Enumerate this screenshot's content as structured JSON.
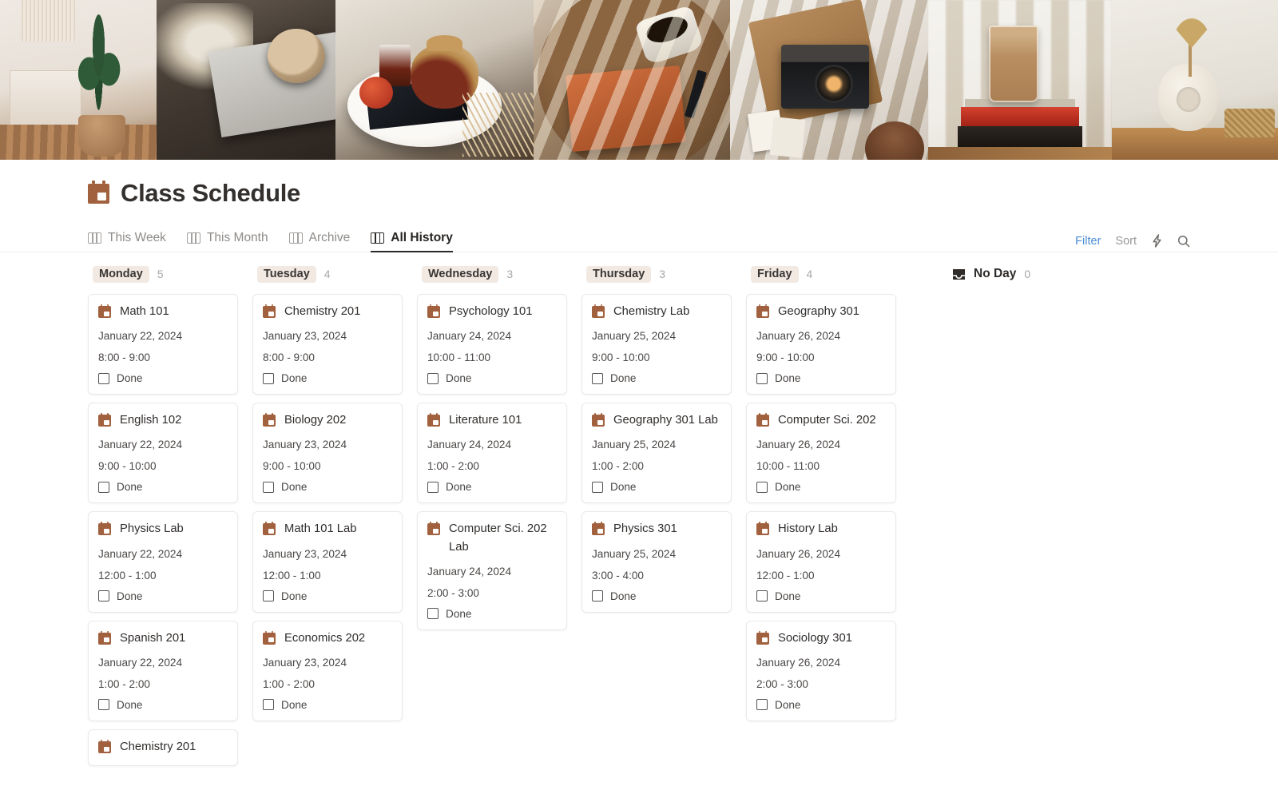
{
  "header": {
    "title": "Class Schedule",
    "title_icon": "calendar-icon"
  },
  "tabs": [
    {
      "label": "This Week",
      "icon": "board-view-icon",
      "active": false
    },
    {
      "label": "This Month",
      "icon": "board-view-icon",
      "active": false
    },
    {
      "label": "Archive",
      "icon": "board-view-icon",
      "active": false
    },
    {
      "label": "All History",
      "icon": "board-view-icon",
      "active": true
    }
  ],
  "toolbar": {
    "filter_label": "Filter",
    "sort_label": "Sort",
    "automation_icon": "lightning-bolt-icon",
    "search_icon": "search-icon",
    "filter_color": "#4a8bd4",
    "sort_color": "#9b9896"
  },
  "colors": {
    "pill_background": "#f2e9e3",
    "card_icon": "#a2613e",
    "accent_blue": "#4a8bd4",
    "card_border": "#ebe9e7",
    "count_text": "#a9a6a3"
  },
  "board": {
    "done_label": "Done",
    "columns": [
      {
        "name": "Monday",
        "count": "5",
        "cards": [
          {
            "title": "Math 101",
            "date": "January 22, 2024",
            "time": "8:00 - 9:00",
            "done": false
          },
          {
            "title": "English 102",
            "date": "January 22, 2024",
            "time": "9:00 - 10:00",
            "done": false
          },
          {
            "title": "Physics Lab",
            "date": "January 22, 2024",
            "time": "12:00 - 1:00",
            "done": false
          },
          {
            "title": "Spanish 201",
            "date": "January 22, 2024",
            "time": "1:00 - 2:00",
            "done": false
          },
          {
            "title": "Chemistry 201",
            "date": "",
            "time": "",
            "done": false
          }
        ]
      },
      {
        "name": "Tuesday",
        "count": "4",
        "cards": [
          {
            "title": "Chemistry 201",
            "date": "January 23, 2024",
            "time": "8:00 - 9:00",
            "done": false
          },
          {
            "title": "Biology 202",
            "date": "January 23, 2024",
            "time": "9:00 - 10:00",
            "done": false
          },
          {
            "title": "Math 101 Lab",
            "date": "January 23, 2024",
            "time": "12:00 - 1:00",
            "done": false
          },
          {
            "title": "Economics 202",
            "date": "January 23, 2024",
            "time": "1:00 - 2:00",
            "done": false
          }
        ]
      },
      {
        "name": "Wednesday",
        "count": "3",
        "cards": [
          {
            "title": "Psychology 101",
            "date": "January 24, 2024",
            "time": "10:00 - 11:00",
            "done": false
          },
          {
            "title": "Literature 101",
            "date": "January 24, 2024",
            "time": "1:00 - 2:00",
            "done": false
          },
          {
            "title": "Computer Sci. 202 Lab",
            "date": "January 24, 2024",
            "time": "2:00 - 3:00",
            "done": false
          }
        ]
      },
      {
        "name": "Thursday",
        "count": "3",
        "cards": [
          {
            "title": "Chemistry Lab",
            "date": "January 25, 2024",
            "time": "9:00 - 10:00",
            "done": false
          },
          {
            "title": "Geography 301 Lab",
            "date": "January 25, 2024",
            "time": "1:00 - 2:00",
            "done": false
          },
          {
            "title": "Physics 301",
            "date": "January 25, 2024",
            "time": "3:00 - 4:00",
            "done": false
          }
        ]
      },
      {
        "name": "Friday",
        "count": "4",
        "cards": [
          {
            "title": "Geography 301",
            "date": "January 26, 2024",
            "time": "9:00 - 10:00",
            "done": false
          },
          {
            "title": "Computer Sci. 202",
            "date": "January 26, 2024",
            "time": "10:00 - 11:00",
            "done": false
          },
          {
            "title": "History Lab",
            "date": "January 26, 2024",
            "time": "12:00 - 1:00",
            "done": false
          },
          {
            "title": "Sociology 301",
            "date": "January 26, 2024",
            "time": "2:00 - 3:00",
            "done": false
          }
        ]
      }
    ],
    "no_day": {
      "label": "No Day",
      "count": "0",
      "icon": "inbox-icon",
      "cards": []
    }
  },
  "banner": {
    "alt": "photo collage banner",
    "panes": [
      "cactus-plant-dresser-photo",
      "coffee-cup-on-book-photo",
      "teapot-apple-white-table-photo",
      "journal-mug-wood-table-photo",
      "film-camera-linen-polaroids-photo",
      "latte-glass-on-books-photo",
      "ceramic-vase-dried-palm-photo"
    ]
  }
}
